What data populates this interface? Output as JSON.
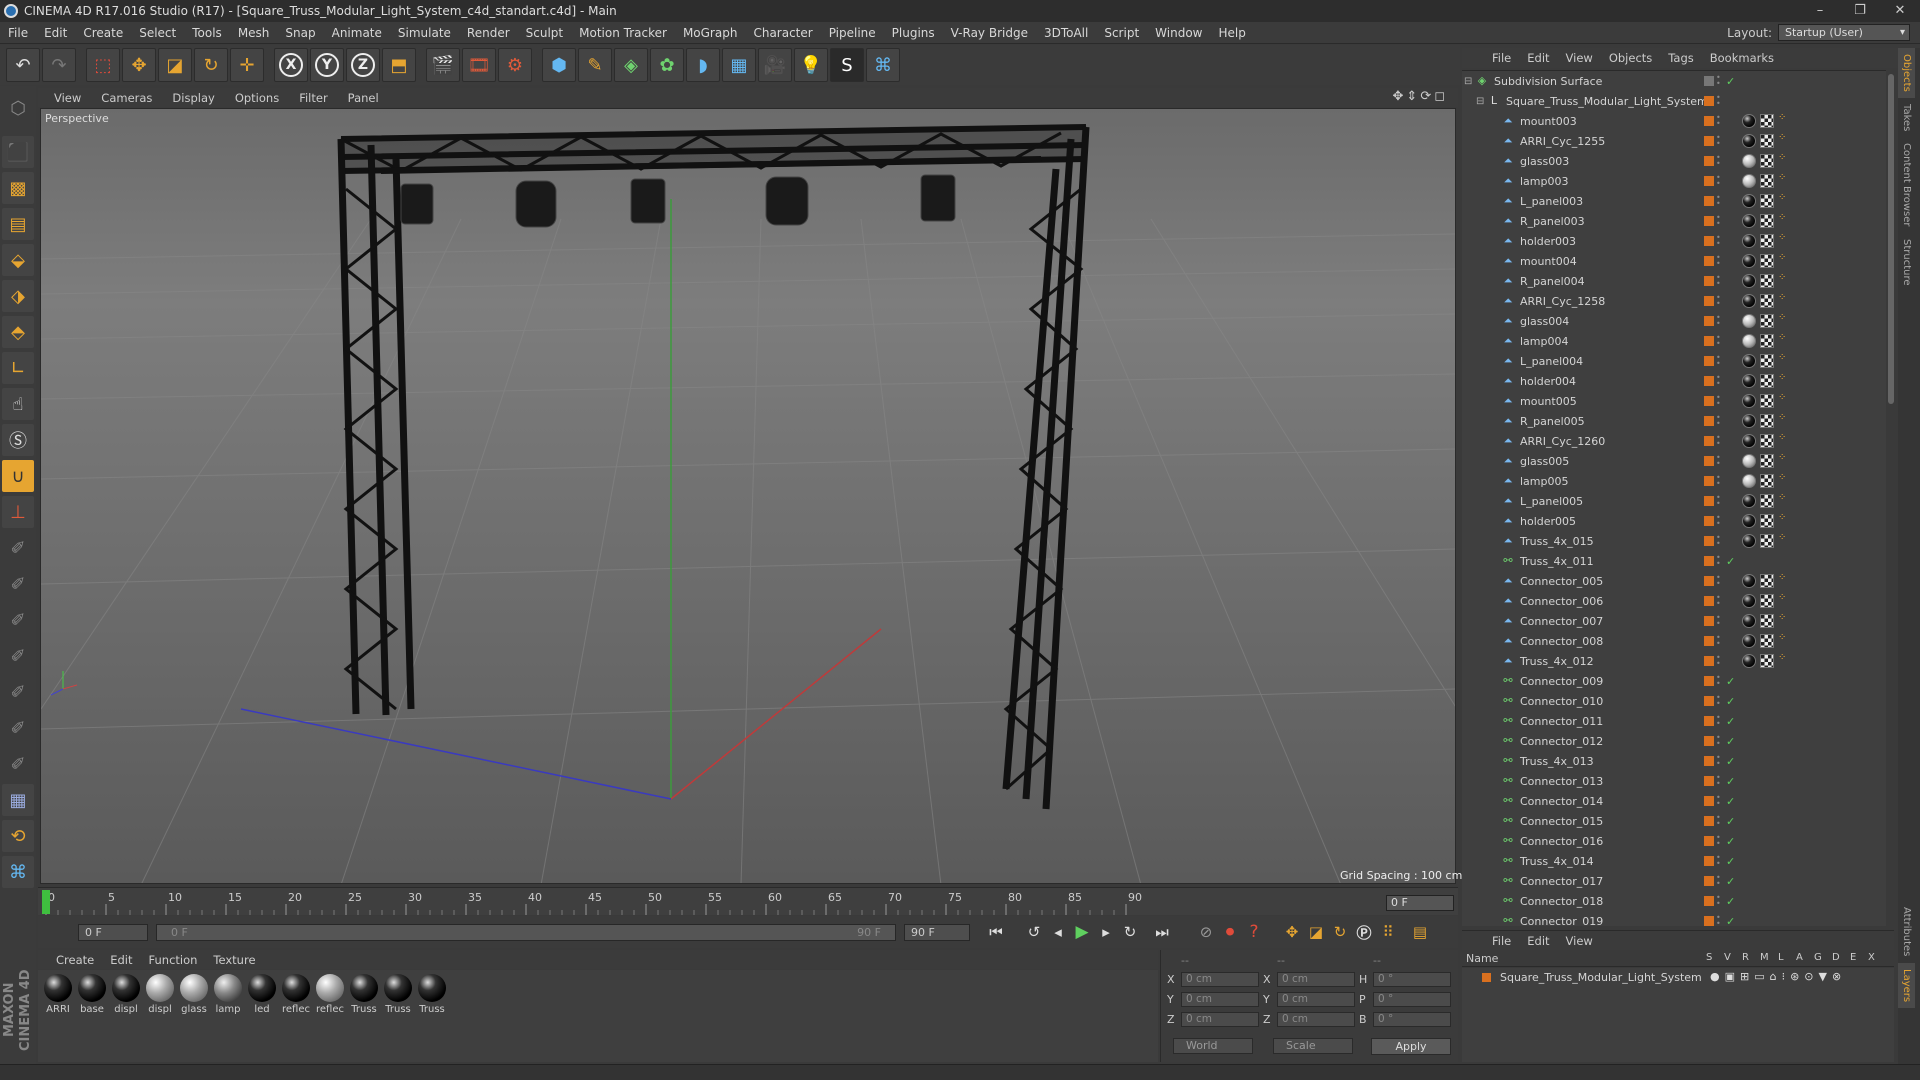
{
  "window": {
    "title": "CINEMA 4D R17.016 Studio (R17) - [Square_Truss_Modular_Light_System_c4d_standart.c4d] - Main",
    "controls": [
      "–",
      "❐",
      "✕"
    ]
  },
  "menubar": {
    "items": [
      "File",
      "Edit",
      "Create",
      "Select",
      "Tools",
      "Mesh",
      "Snap",
      "Animate",
      "Simulate",
      "Render",
      "Sculpt",
      "Motion Tracker",
      "MoGraph",
      "Character",
      "Pipeline",
      "Plugins",
      "V-Ray Bridge",
      "3DToAll",
      "Script",
      "Window",
      "Help"
    ],
    "layout_label": "Layout:",
    "layout_value": "Startup (User)"
  },
  "toolbar": {
    "icons": [
      "undo-icon",
      "redo-icon",
      "live-selection-icon",
      "move-icon",
      "scale-icon",
      "rotate-icon",
      "recent-tool-icon",
      "x-axis-icon",
      "y-axis-icon",
      "z-axis-icon",
      "coordinate-system-icon",
      "render-view-icon",
      "render-picture-viewer-icon",
      "edit-render-settings-icon",
      "cube-icon",
      "pen-icon",
      "subdivision-icon",
      "cloner-icon",
      "deformer-icon",
      "floor-icon",
      "camera-icon",
      "light-icon",
      "sketch-icon",
      "python-icon"
    ],
    "axis_labels": [
      "X",
      "Y",
      "Z"
    ]
  },
  "viewport": {
    "menu": [
      "View",
      "Cameras",
      "Display",
      "Options",
      "Filter",
      "Panel"
    ],
    "view_name": "Perspective",
    "grid_spacing": "Grid Spacing : 100 cm"
  },
  "timeline": {
    "ticks": [
      "0",
      "5",
      "10",
      "15",
      "20",
      "25",
      "30",
      "35",
      "40",
      "45",
      "50",
      "55",
      "60",
      "65",
      "70",
      "75",
      "80",
      "85",
      "90"
    ],
    "frame_right": "0 F"
  },
  "transport": {
    "current_frame": "0 F",
    "range_start": "0 F",
    "range_end": "90 F",
    "max_frame": "90 F"
  },
  "materials": {
    "menu": [
      "Create",
      "Edit",
      "Function",
      "Texture"
    ],
    "items": [
      {
        "name": "ARRI",
        "style": "dark"
      },
      {
        "name": "base",
        "style": "dark"
      },
      {
        "name": "displ",
        "style": "dark"
      },
      {
        "name": "displ",
        "style": "light"
      },
      {
        "name": "glass",
        "style": "light"
      },
      {
        "name": "lamp",
        "style": "grey"
      },
      {
        "name": "led",
        "style": "dark"
      },
      {
        "name": "reflec",
        "style": "dark"
      },
      {
        "name": "reflec",
        "style": "light"
      },
      {
        "name": "Truss",
        "style": "dark"
      },
      {
        "name": "Truss",
        "style": "dark"
      },
      {
        "name": "Truss",
        "style": "dark"
      }
    ]
  },
  "coordinates": {
    "header": [
      "--",
      "--",
      "--"
    ],
    "rows": [
      {
        "a": "X",
        "av": "0 cm",
        "b": "X",
        "bv": "0 cm",
        "c": "H",
        "cv": "0 °"
      },
      {
        "a": "Y",
        "av": "0 cm",
        "b": "Y",
        "bv": "0 cm",
        "c": "P",
        "cv": "0 °"
      },
      {
        "a": "Z",
        "av": "0 cm",
        "b": "Z",
        "bv": "0 cm",
        "c": "B",
        "cv": "0 °"
      }
    ],
    "space": "World",
    "mode": "Scale",
    "apply": "Apply"
  },
  "objects": {
    "menu": [
      "File",
      "Edit",
      "View",
      "Objects",
      "Tags",
      "Bookmarks"
    ],
    "items": [
      {
        "name": "Subdivision Surface",
        "level": 0,
        "type": "subdiv",
        "tags": ""
      },
      {
        "name": "Square_Truss_Modular_Light_System",
        "level": 1,
        "type": "null",
        "tags": ""
      },
      {
        "name": "mount003",
        "level": 2,
        "type": "poly",
        "tags": "dark"
      },
      {
        "name": "ARRI_Cyc_1255",
        "level": 2,
        "type": "poly",
        "tags": "dark"
      },
      {
        "name": "glass003",
        "level": 2,
        "type": "poly",
        "tags": "light"
      },
      {
        "name": "lamp003",
        "level": 2,
        "type": "poly",
        "tags": "light"
      },
      {
        "name": "L_panel003",
        "level": 2,
        "type": "poly",
        "tags": "dark"
      },
      {
        "name": "R_panel003",
        "level": 2,
        "type": "poly",
        "tags": "dark"
      },
      {
        "name": "holder003",
        "level": 2,
        "type": "poly",
        "tags": "dark"
      },
      {
        "name": "mount004",
        "level": 2,
        "type": "poly",
        "tags": "dark"
      },
      {
        "name": "R_panel004",
        "level": 2,
        "type": "poly",
        "tags": "dark"
      },
      {
        "name": "ARRI_Cyc_1258",
        "level": 2,
        "type": "poly",
        "tags": "dark"
      },
      {
        "name": "glass004",
        "level": 2,
        "type": "poly",
        "tags": "light"
      },
      {
        "name": "lamp004",
        "level": 2,
        "type": "poly",
        "tags": "light"
      },
      {
        "name": "L_panel004",
        "level": 2,
        "type": "poly",
        "tags": "dark"
      },
      {
        "name": "holder004",
        "level": 2,
        "type": "poly",
        "tags": "dark"
      },
      {
        "name": "mount005",
        "level": 2,
        "type": "poly",
        "tags": "dark"
      },
      {
        "name": "R_panel005",
        "level": 2,
        "type": "poly",
        "tags": "dark"
      },
      {
        "name": "ARRI_Cyc_1260",
        "level": 2,
        "type": "poly",
        "tags": "dark"
      },
      {
        "name": "glass005",
        "level": 2,
        "type": "poly",
        "tags": "light"
      },
      {
        "name": "lamp005",
        "level": 2,
        "type": "poly",
        "tags": "light"
      },
      {
        "name": "L_panel005",
        "level": 2,
        "type": "poly",
        "tags": "dark"
      },
      {
        "name": "holder005",
        "level": 2,
        "type": "poly",
        "tags": "dark"
      },
      {
        "name": "Truss_4x_015",
        "level": 2,
        "type": "poly",
        "tags": "dark"
      },
      {
        "name": "Truss_4x_011",
        "level": 2,
        "type": "inst",
        "tags": ""
      },
      {
        "name": "Connector_005",
        "level": 2,
        "type": "poly",
        "tags": "dark"
      },
      {
        "name": "Connector_006",
        "level": 2,
        "type": "poly",
        "tags": "dark"
      },
      {
        "name": "Connector_007",
        "level": 2,
        "type": "poly",
        "tags": "dark"
      },
      {
        "name": "Connector_008",
        "level": 2,
        "type": "poly",
        "tags": "dark"
      },
      {
        "name": "Truss_4x_012",
        "level": 2,
        "type": "poly",
        "tags": "dark"
      },
      {
        "name": "Connector_009",
        "level": 2,
        "type": "inst",
        "tags": ""
      },
      {
        "name": "Connector_010",
        "level": 2,
        "type": "inst",
        "tags": ""
      },
      {
        "name": "Connector_011",
        "level": 2,
        "type": "inst",
        "tags": ""
      },
      {
        "name": "Connector_012",
        "level": 2,
        "type": "inst",
        "tags": ""
      },
      {
        "name": "Truss_4x_013",
        "level": 2,
        "type": "inst",
        "tags": ""
      },
      {
        "name": "Connector_013",
        "level": 2,
        "type": "inst",
        "tags": ""
      },
      {
        "name": "Connector_014",
        "level": 2,
        "type": "inst",
        "tags": ""
      },
      {
        "name": "Connector_015",
        "level": 2,
        "type": "inst",
        "tags": ""
      },
      {
        "name": "Connector_016",
        "level": 2,
        "type": "inst",
        "tags": ""
      },
      {
        "name": "Truss_4x_014",
        "level": 2,
        "type": "inst",
        "tags": ""
      },
      {
        "name": "Connector_017",
        "level": 2,
        "type": "inst",
        "tags": ""
      },
      {
        "name": "Connector_018",
        "level": 2,
        "type": "inst",
        "tags": ""
      },
      {
        "name": "Connector_019",
        "level": 2,
        "type": "inst",
        "tags": ""
      }
    ]
  },
  "layers": {
    "menu": [
      "File",
      "Edit",
      "View"
    ],
    "header_name": "Name",
    "columns": [
      "S",
      "V",
      "R",
      "M",
      "L",
      "A",
      "G",
      "D",
      "E",
      "X"
    ],
    "items": [
      "Square_Truss_Modular_Light_System"
    ]
  },
  "right_tabs": [
    "Objects",
    "Takes",
    "Content Browser",
    "Structure",
    "Attributes",
    "Layers"
  ],
  "branding": "MAXON CINEMA 4D",
  "colors": {
    "accent": "#e6a531",
    "layer": "#d9701f",
    "check": "#5fd05f"
  }
}
